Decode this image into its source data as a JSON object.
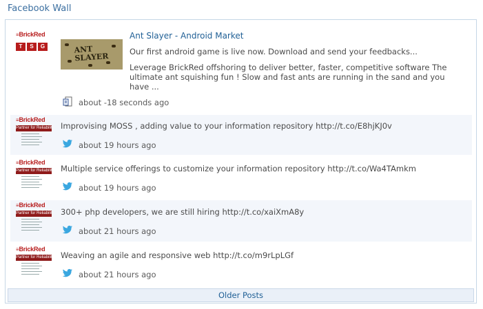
{
  "widget": {
    "title": "Facebook Wall"
  },
  "featured": {
    "logo_text": "BrickRed",
    "badge_letters": [
      "T",
      "S",
      "G"
    ],
    "thumbnail_text": "ANT SLAYER",
    "title": "Ant Slayer - Android Market",
    "caption": "Our first android game is live now. Download and send your feedbacks...",
    "description": "Leverage BrickRed offshoring to deliver better, faster, competitive software The ultimate ant squishing fun ! Slow and fast ants are running in the sand and you have ...",
    "time": "about -18 seconds ago",
    "source_icon": "facebook-share-icon"
  },
  "tweets": [
    {
      "logo_text": "BrickRed",
      "banner": "Partner for Reliability",
      "text": "Improvising MOSS , adding value to your information repository http://t.co/E8hjKJ0v",
      "time": "about 19 hours ago",
      "source_icon": "twitter-bird-icon"
    },
    {
      "logo_text": "BrickRed",
      "banner": "Partner for Reliability",
      "text": "Multiple service offerings to customize your information repository http://t.co/Wa4TAmkm",
      "time": "about 19 hours ago",
      "source_icon": "twitter-bird-icon"
    },
    {
      "logo_text": "BrickRed",
      "banner": "Partner for Reliability",
      "text": "300+ php developers, we are still hiring http://t.co/xaiXmA8y",
      "time": "about 21 hours ago",
      "source_icon": "twitter-bird-icon"
    },
    {
      "logo_text": "BrickRed",
      "banner": "Partner for Reliability",
      "text": "Weaving an agile and responsive web http://t.co/m9rLpLGf",
      "time": "about 21 hours ago",
      "source_icon": "twitter-bird-icon"
    }
  ],
  "pager": {
    "older_label": "Older Posts"
  },
  "colors": {
    "link": "#1f5f95",
    "brand_red": "#b71c1c",
    "border": "#c5d6e6",
    "row_shade": "#f3f6fb"
  }
}
